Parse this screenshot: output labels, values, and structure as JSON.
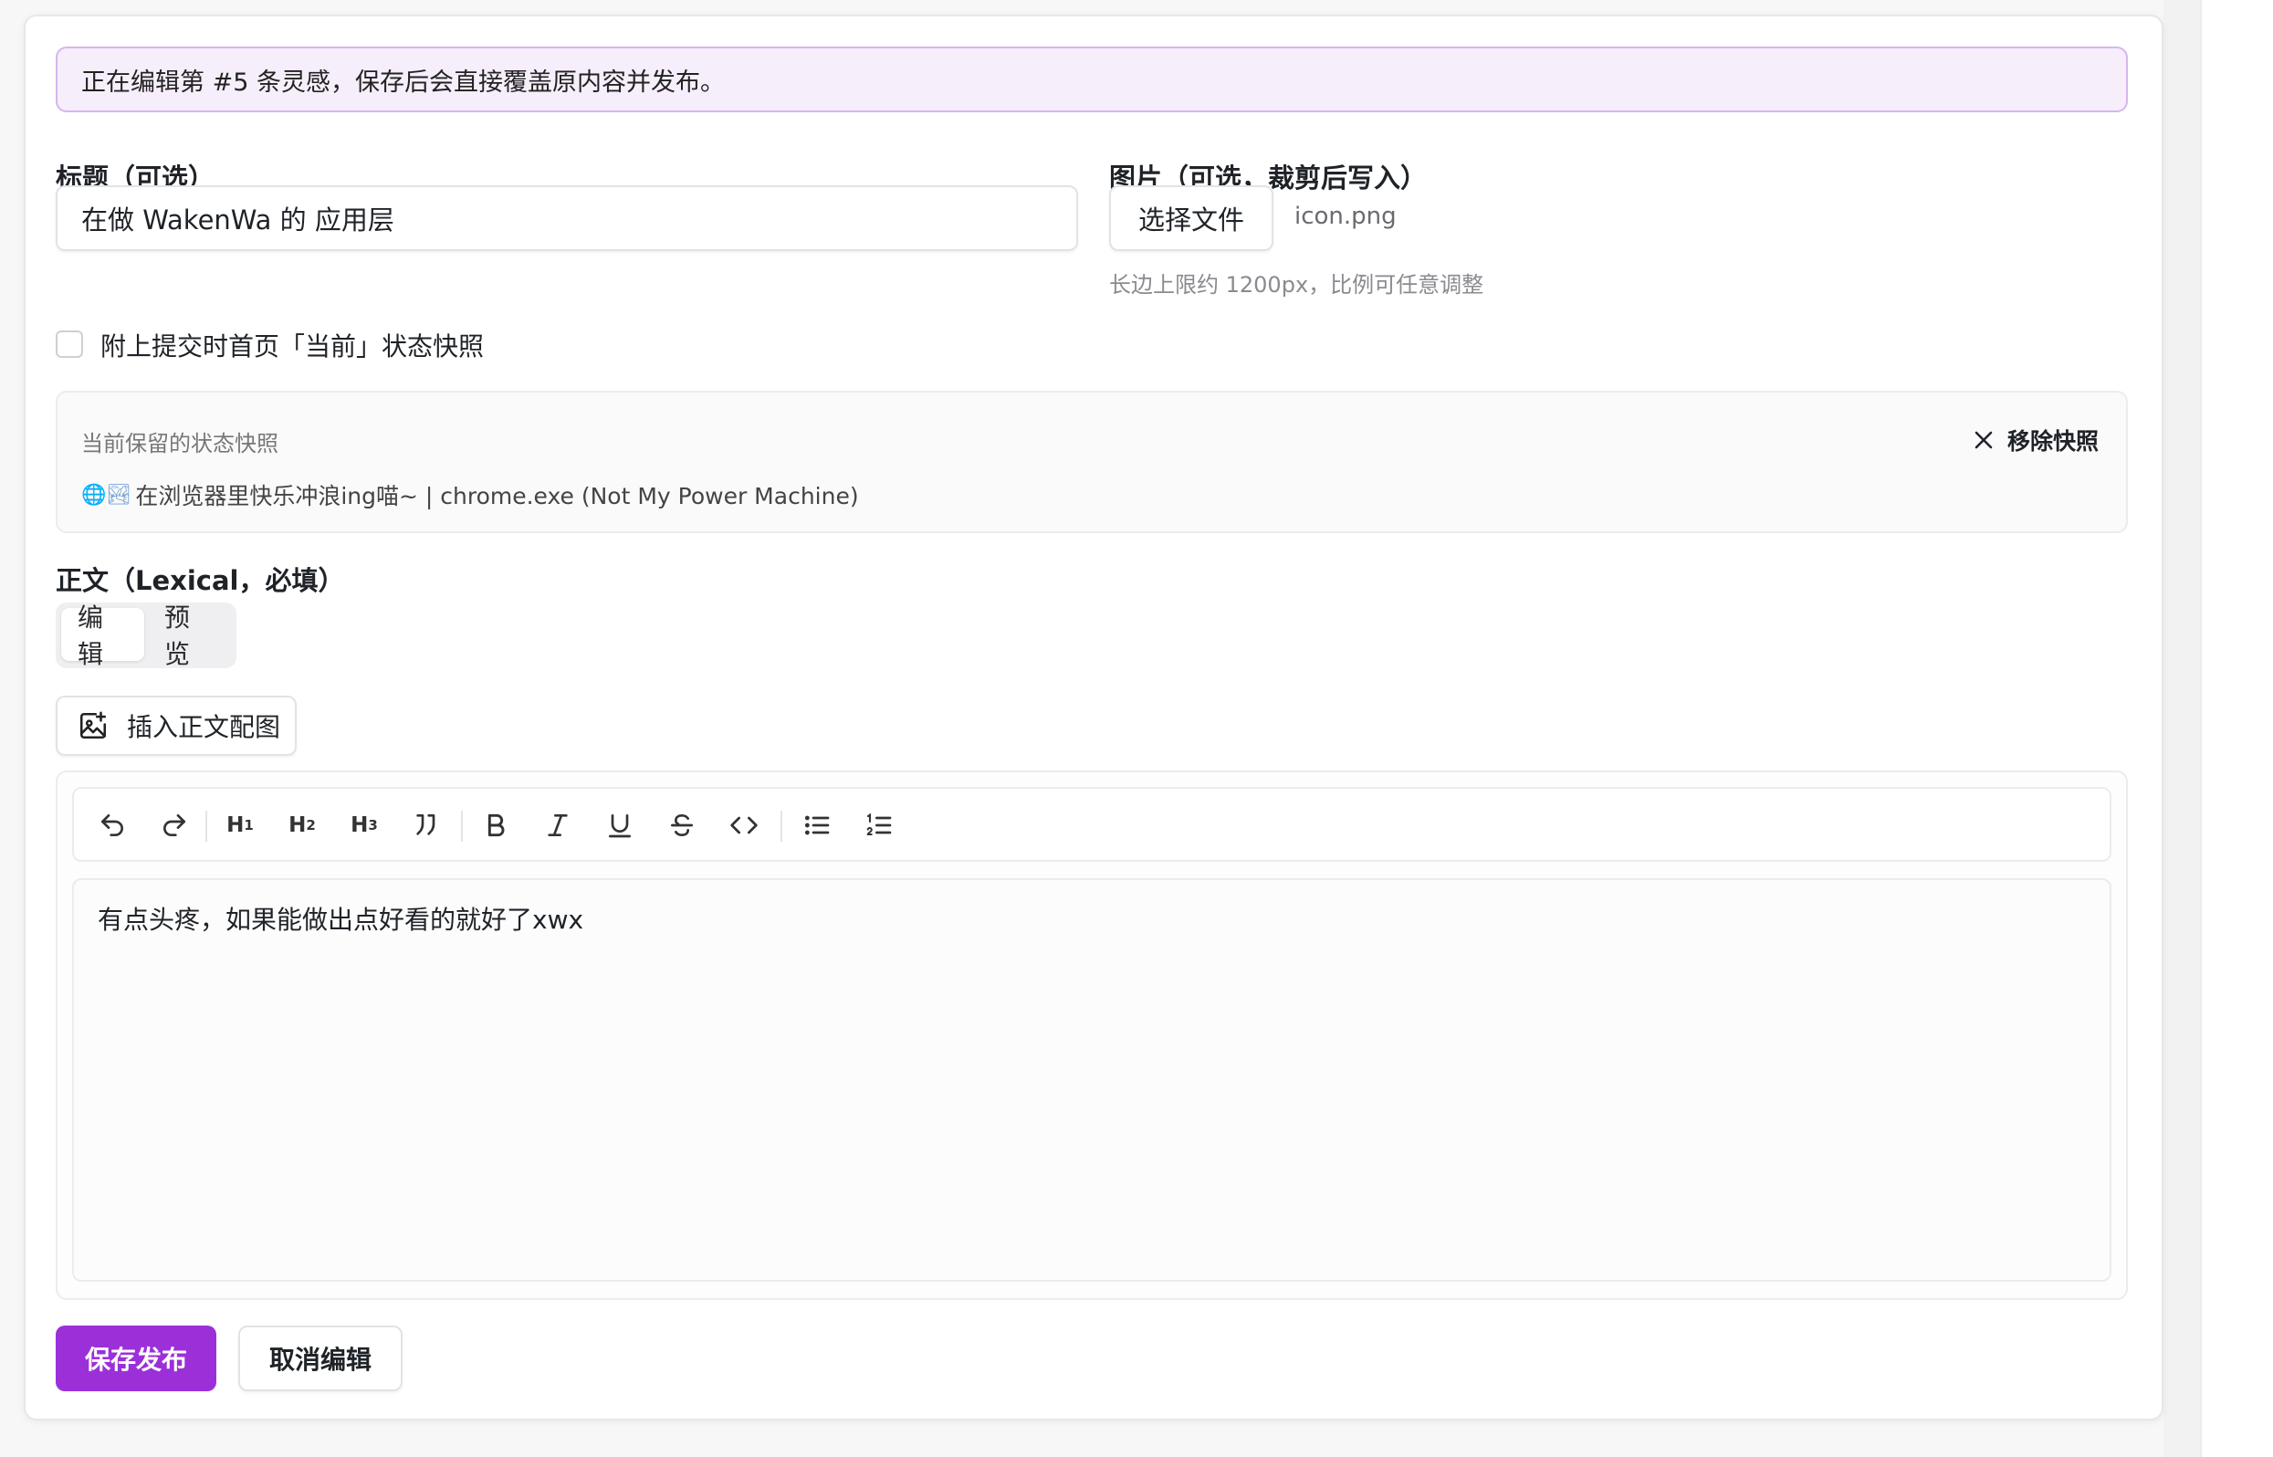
{
  "notice": "正在编辑第 #5 条灵感，保存后会直接覆盖原内容并发布。",
  "title_field": {
    "label": "标题（可选）",
    "value": "在做 WakenWa 的 应用层"
  },
  "image_field": {
    "label": "图片（可选，裁剪后写入）",
    "choose_button": "选择文件",
    "file_name": "icon.png",
    "hint": "长边上限约 1200px，比例可任意调整"
  },
  "snapshot_checkbox": {
    "label": "附上提交时首页「当前」状态快照",
    "checked": false
  },
  "snapshot": {
    "title": "当前保留的状态快照",
    "icons": "🌐🏞",
    "text": "在浏览器里快乐冲浪ing喵~ | chrome.exe (Not My Power Machine)",
    "remove_label": "移除快照"
  },
  "body_field": {
    "label": "正文（Lexical，必填）",
    "tabs": [
      {
        "label": "编辑",
        "active": true
      },
      {
        "label": "预览",
        "active": false
      }
    ],
    "insert_image_label": "插入正文配图"
  },
  "toolbar": {
    "h1": "H",
    "h1_sub": "1",
    "h2": "H",
    "h2_sub": "2",
    "h3": "H",
    "h3_sub": "3",
    "items": [
      "undo-icon",
      "redo-icon",
      "heading-1",
      "heading-2",
      "heading-3",
      "quote-icon",
      "bold-icon",
      "italic-icon",
      "underline-icon",
      "strikethrough-icon",
      "code-icon",
      "bullet-list-icon",
      "numbered-list-icon"
    ]
  },
  "editor": {
    "content": "有点头疼，如果能做出点好看的就好了xwx"
  },
  "actions": {
    "save": "保存发布",
    "cancel": "取消编辑"
  },
  "colors": {
    "accent": "#9b30d9",
    "notice_bg": "#f6eefb",
    "notice_border": "#d7b5ef"
  }
}
